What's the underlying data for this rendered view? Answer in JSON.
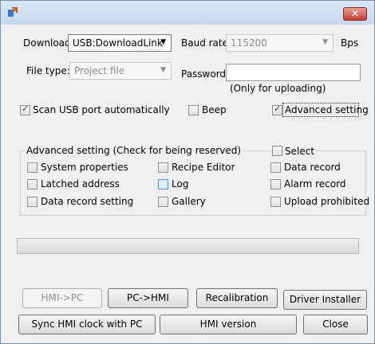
{
  "window": {
    "close_glyph": "✕",
    "icon": "app-icon"
  },
  "download": {
    "label": "Download",
    "value": "USB:DownloadLink"
  },
  "baud": {
    "label": "Baud rate:",
    "value": "115200",
    "unit": "Bps"
  },
  "filetype": {
    "label": "File type:",
    "value": "Project file"
  },
  "password": {
    "label": "Password:",
    "value": "",
    "note": "(Only for uploading)"
  },
  "options": {
    "scan_usb": {
      "label": "Scan USB port automatically",
      "checked": true
    },
    "beep": {
      "label": "Beep",
      "checked": false
    },
    "advanced": {
      "label": "Advanced setting",
      "checked": true
    }
  },
  "advanced_group": {
    "title": "Advanced setting (Check for being reserved)",
    "select_label": "Select",
    "items": [
      {
        "label": "System properties",
        "checked": false
      },
      {
        "label": "Recipe Editor",
        "checked": false
      },
      {
        "label": "Data record",
        "checked": false
      },
      {
        "label": "Latched address",
        "checked": false
      },
      {
        "label": "Log",
        "checked": false
      },
      {
        "label": "Alarm record",
        "checked": false
      },
      {
        "label": "Data record setting",
        "checked": false
      },
      {
        "label": "Gallery",
        "checked": false
      },
      {
        "label": "Upload prohibited",
        "checked": false
      }
    ]
  },
  "progress": {
    "value": 0
  },
  "buttons": {
    "hmi_to_pc": "HMI->PC",
    "pc_to_hmi": "PC->HMI",
    "recalibration": "Recalibration",
    "driver_installer": "Driver Installer",
    "sync_clock": "Sync HMI clock with PC",
    "hmi_version": "HMI version",
    "close": "Close"
  }
}
